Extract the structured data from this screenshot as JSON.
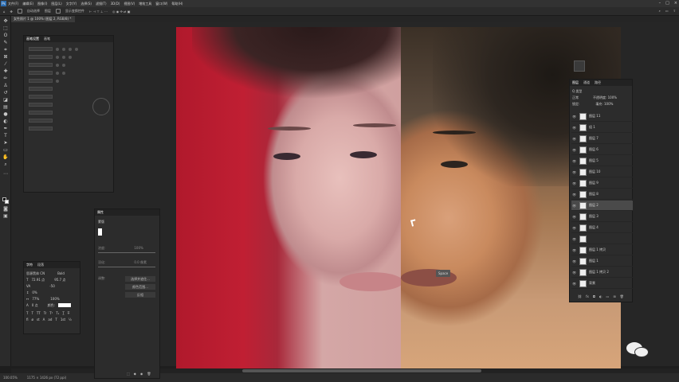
{
  "menubar": {
    "items": [
      "文件(F)",
      "编辑(E)",
      "图像(I)",
      "图层(L)",
      "文字(Y)",
      "选择(S)",
      "滤镜(T)",
      "3D(D)",
      "视图(V)",
      "增效工具",
      "窗口(W)",
      "帮助(H)"
    ]
  },
  "options": {
    "mode_label": "自动选择",
    "layer_label": "图层",
    "show_transform": "显示变换控件"
  },
  "document_tab": "女性照片 1 @ 100% (图层 2, RGB/8) *",
  "tooltip": "Space",
  "status": {
    "zoom": "100.05%",
    "doc": "1175 × 1426 px (72 ppi)"
  },
  "brushpanel": {
    "tabs": [
      "画笔设置",
      "画笔"
    ]
  },
  "props": {
    "title": "属性",
    "mode_label": "蒙版",
    "density_label": "浓度:",
    "density_val": "100%",
    "feather_label": "羽化:",
    "feather_val": "0.0 像素",
    "adjust_label": "调整:",
    "btn1": "选择并遮住...",
    "btn2": "颜色范围...",
    "btn3": "反相"
  },
  "charpanel": {
    "tabs": [
      "字符",
      "段落"
    ],
    "font": "思源黑体 CN",
    "style": "Bold",
    "size": "72.91 点",
    "leading": "95.7 点",
    "tracking": "-50",
    "scale_v": "0%",
    "scale_h": "77%",
    "scale2": "100%",
    "baseline": "0 点",
    "color_label": "颜色:"
  },
  "layers": {
    "tabs": [
      "图层",
      "通道",
      "路径"
    ],
    "kind": "Q 类型",
    "blend": "正常",
    "opacity": "不透明度: 100%",
    "fill": "填充: 100%",
    "lock": "锁定:",
    "items": [
      {
        "name": "图层 11",
        "sel": false
      },
      {
        "name": "组 1",
        "sel": false
      },
      {
        "name": "图层 7",
        "sel": false
      },
      {
        "name": "图层 6",
        "sel": false
      },
      {
        "name": "图层 5",
        "sel": false
      },
      {
        "name": "图层 10",
        "sel": false
      },
      {
        "name": "图层 9",
        "sel": false
      },
      {
        "name": "图层 8",
        "sel": false
      },
      {
        "name": "图层 2",
        "sel": true
      },
      {
        "name": "图层 3",
        "sel": false
      },
      {
        "name": "图层 4",
        "sel": false
      },
      {
        "name": "",
        "sel": false
      },
      {
        "name": "图层 1 拷贝",
        "sel": false
      },
      {
        "name": "图层 1",
        "sel": false
      },
      {
        "name": "图层 1 拷贝 2",
        "sel": false
      },
      {
        "name": "背景",
        "sel": false
      }
    ]
  }
}
